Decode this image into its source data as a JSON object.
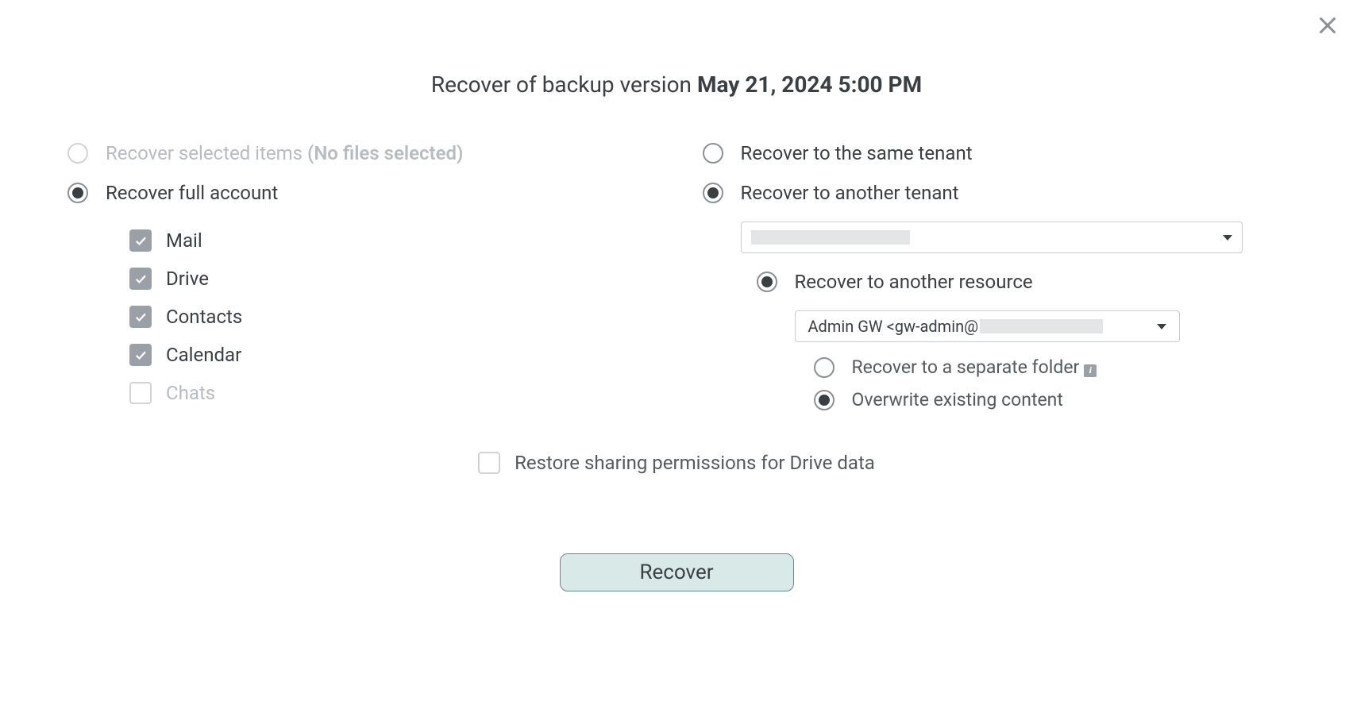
{
  "title": {
    "prefix": "Recover of backup version ",
    "bold": "May 21, 2024 5:00 PM"
  },
  "left": {
    "option_selected_items": "Recover selected items ",
    "option_selected_items_paren": "(No files selected)",
    "option_full_account": "Recover full account",
    "checkboxes": {
      "mail": "Mail",
      "drive": "Drive",
      "contacts": "Contacts",
      "calendar": "Calendar",
      "chats": "Chats"
    }
  },
  "right": {
    "option_same_tenant": "Recover to the same tenant",
    "option_another_tenant": "Recover to another tenant",
    "option_another_resource": "Recover to another resource",
    "resource_value_prefix": "Admin GW <gw-admin@",
    "mode_separate_folder": "Recover to a separate folder",
    "mode_overwrite": "Overwrite existing content"
  },
  "bottom": {
    "restore_sharing": "Restore sharing permissions for Drive data"
  },
  "button": {
    "recover": "Recover"
  }
}
